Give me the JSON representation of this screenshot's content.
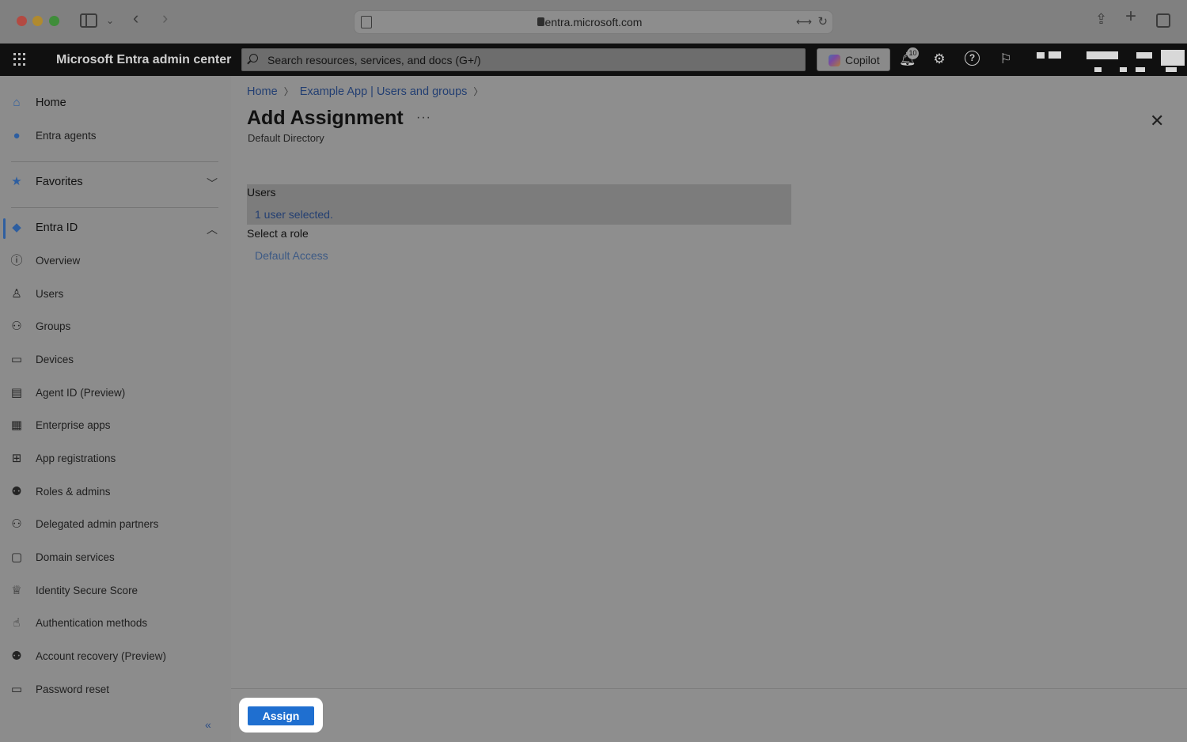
{
  "browser": {
    "url": "entra.microsoft.com"
  },
  "header": {
    "app_title": "Microsoft Entra admin center",
    "search_placeholder": "Search resources, services, and docs (G+/)",
    "copilot_label": "Copilot",
    "notification_count": "10",
    "help_glyph": "?"
  },
  "sidebar": {
    "top_items": [
      {
        "label": "Home",
        "icon": "home-icon"
      },
      {
        "label": "Entra agents",
        "icon": "agents-icon"
      }
    ],
    "favorites_label": "Favorites",
    "section_label": "Entra ID",
    "items": [
      {
        "label": "Overview",
        "icon": "info-icon"
      },
      {
        "label": "Users",
        "icon": "user-icon"
      },
      {
        "label": "Groups",
        "icon": "groups-icon"
      },
      {
        "label": "Devices",
        "icon": "devices-icon"
      },
      {
        "label": "Agent ID (Preview)",
        "icon": "id-card-icon"
      },
      {
        "label": "Enterprise apps",
        "icon": "enterprise-apps-icon"
      },
      {
        "label": "App registrations",
        "icon": "app-registrations-icon"
      },
      {
        "label": "Roles & admins",
        "icon": "roles-icon"
      },
      {
        "label": "Delegated admin partners",
        "icon": "partners-icon"
      },
      {
        "label": "Domain services",
        "icon": "domain-icon"
      },
      {
        "label": "Identity Secure Score",
        "icon": "trophy-icon"
      },
      {
        "label": "Authentication methods",
        "icon": "auth-icon"
      },
      {
        "label": "Account recovery (Preview)",
        "icon": "recovery-icon"
      },
      {
        "label": "Password reset",
        "icon": "password-icon"
      }
    ],
    "collapse_glyph": "«"
  },
  "main": {
    "breadcrumb": [
      "Home",
      "Example App | Users and groups"
    ],
    "title": "Add Assignment",
    "more_glyph": "···",
    "subtitle": "Default Directory",
    "users_label": "Users",
    "users_value": "1 user selected.",
    "role_label": "Select a role",
    "role_value": "Default Access",
    "assign_label": "Assign"
  },
  "colors": {
    "accent": "#1f6fd0",
    "link": "#233f72",
    "header_bg": "#101010"
  }
}
